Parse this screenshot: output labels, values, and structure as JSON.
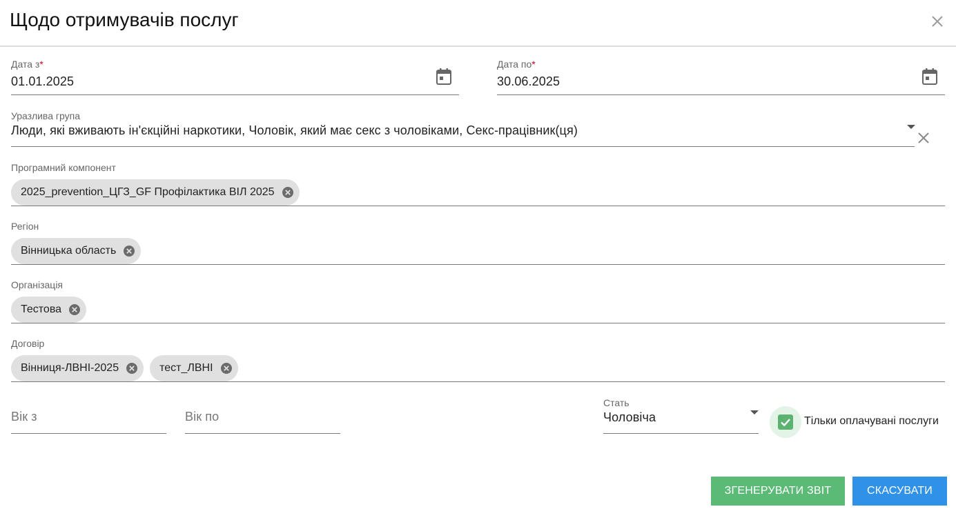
{
  "dialog": {
    "title": "Щодо отримувачів послуг"
  },
  "date_from": {
    "label": "Дата з",
    "required_mark": "*",
    "value": "01.01.2025"
  },
  "date_to": {
    "label": "Дата по",
    "required_mark": "*",
    "value": "30.06.2025"
  },
  "vulnerable_group": {
    "label": "Уразлива група",
    "value": "Люди, які вживають ін'єкційні наркотики, Чоловік, який має секс з чоловіками, Секс-працівник(ця)"
  },
  "program_component": {
    "label": "Програмний компонент",
    "chips": [
      "2025_prevention_ЦГЗ_GF Профілактика ВІЛ 2025"
    ]
  },
  "region": {
    "label": "Регіон",
    "chips": [
      "Вінницька область"
    ]
  },
  "organization": {
    "label": "Організація",
    "chips": [
      "Тестова"
    ]
  },
  "contract": {
    "label": "Договір",
    "chips": [
      "Вінниця-ЛВНІ-2025",
      "тест_ЛВНІ"
    ]
  },
  "age_from": {
    "placeholder": "Вік з"
  },
  "age_to": {
    "placeholder": "Вік по"
  },
  "gender": {
    "label": "Стать",
    "value": "Чоловіча"
  },
  "paid_only": {
    "label": "Тільки оплачувані послуги",
    "checked": true
  },
  "actions": {
    "generate_label": "ЗГЕНЕРУВАТИ ЗВІТ",
    "cancel_label": "СКАСУВАТИ"
  },
  "colors": {
    "accent_green": "#5cba77",
    "accent_blue": "#2f92e8",
    "required": "#d0021b",
    "chip_bg": "#e0e0e0"
  }
}
